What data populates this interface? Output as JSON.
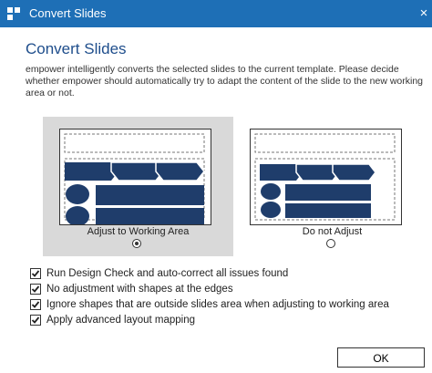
{
  "window": {
    "title": "Convert Slides",
    "close_glyph": "×",
    "app_icon": "empower-icon",
    "accent": "#1e6fb6"
  },
  "heading": "Convert Slides",
  "description": "empower intelligently converts the selected slides to the current template. Please decide whether empower should automatically try to adapt the content of the slide to the new working area or not.",
  "options": [
    {
      "label": "Adjust to Working Area",
      "selected": true
    },
    {
      "label": "Do not Adjust",
      "selected": false
    }
  ],
  "checkboxes": [
    {
      "label": "Run Design Check and auto-correct all issues found",
      "checked": true
    },
    {
      "label": "No adjustment with shapes at the edges",
      "checked": true
    },
    {
      "label": "Ignore shapes that are outside slides area when adjusting to working area",
      "checked": true
    },
    {
      "label": "Apply advanced layout mapping",
      "checked": true
    }
  ],
  "ok_label": "OK",
  "colors": {
    "shape_fill": "#1f3d6b",
    "selected_bg": "#d9d9d9",
    "heading": "#1f4e8c"
  }
}
